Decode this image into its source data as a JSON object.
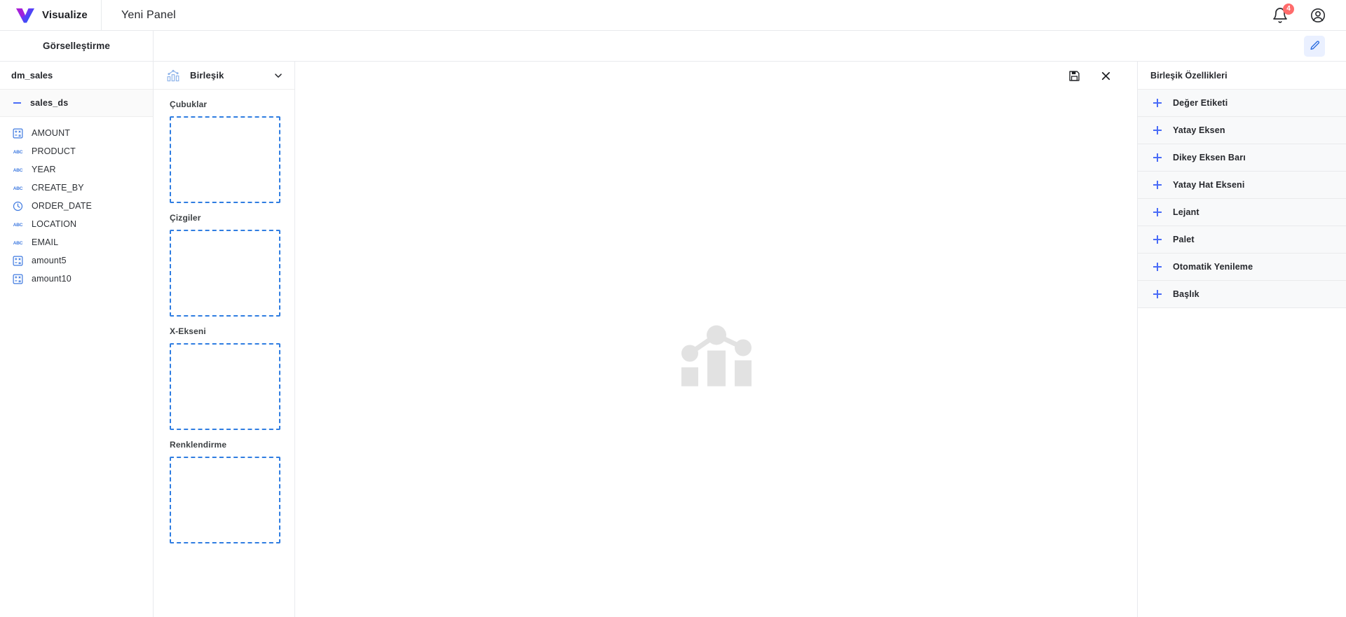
{
  "topbar": {
    "brand_name": "Visualize",
    "brand_logo_icon": "visualize-v-logo",
    "panel_title": "Yeni Panel",
    "notification_icon": "bell-icon",
    "notification_count": "4",
    "account_icon": "account-circle-icon"
  },
  "subbar": {
    "visualization_tab": "Görselleştirme",
    "edit_icon": "pencil-edit-icon"
  },
  "fields_panel": {
    "datasource_title": "dm_sales",
    "dataset": {
      "name": "sales_ds",
      "collapse_icon": "minus-icon"
    },
    "fields": [
      {
        "name": "AMOUNT",
        "type": "numeric",
        "icon": "numeric-field-icon"
      },
      {
        "name": "PRODUCT",
        "type": "text",
        "icon": "abc-text-field-icon"
      },
      {
        "name": "YEAR",
        "type": "text",
        "icon": "abc-text-field-icon"
      },
      {
        "name": "CREATE_BY",
        "type": "text",
        "icon": "abc-text-field-icon"
      },
      {
        "name": "ORDER_DATE",
        "type": "date",
        "icon": "clock-date-field-icon"
      },
      {
        "name": "LOCATION",
        "type": "text",
        "icon": "abc-text-field-icon"
      },
      {
        "name": "EMAIL",
        "type": "text",
        "icon": "abc-text-field-icon"
      },
      {
        "name": "amount5",
        "type": "numeric",
        "icon": "numeric-field-icon"
      },
      {
        "name": "amount10",
        "type": "numeric",
        "icon": "numeric-field-icon"
      }
    ]
  },
  "shelf_panel": {
    "chart_type": {
      "label": "Birleşik",
      "icon": "combo-chart-icon",
      "chevron_icon": "chevron-down-icon"
    },
    "zones": [
      {
        "label": "Çubuklar"
      },
      {
        "label": "Çizgiler"
      },
      {
        "label": "X-Ekseni"
      },
      {
        "label": "Renklendirme"
      }
    ]
  },
  "canvas": {
    "save_icon": "save-floppy-icon",
    "close_icon": "close-x-icon",
    "placeholder_icon": "combo-chart-placeholder"
  },
  "properties_panel": {
    "title": "Birleşik Özellikleri",
    "rows": [
      {
        "label": "Değer Etiketi"
      },
      {
        "label": "Yatay Eksen"
      },
      {
        "label": "Dikey Eksen Barı"
      },
      {
        "label": "Yatay Hat Ekseni"
      },
      {
        "label": "Lejant"
      },
      {
        "label": "Palet"
      },
      {
        "label": "Otomatik Yenileme"
      },
      {
        "label": "Başlık"
      }
    ]
  },
  "colors": {
    "accent_blue": "#4a6cf7",
    "dropzone_blue": "#2f7de1",
    "badge_red": "#ff6b6b",
    "text_dark": "#26282d",
    "panel_grey": "#f8f9fa"
  }
}
